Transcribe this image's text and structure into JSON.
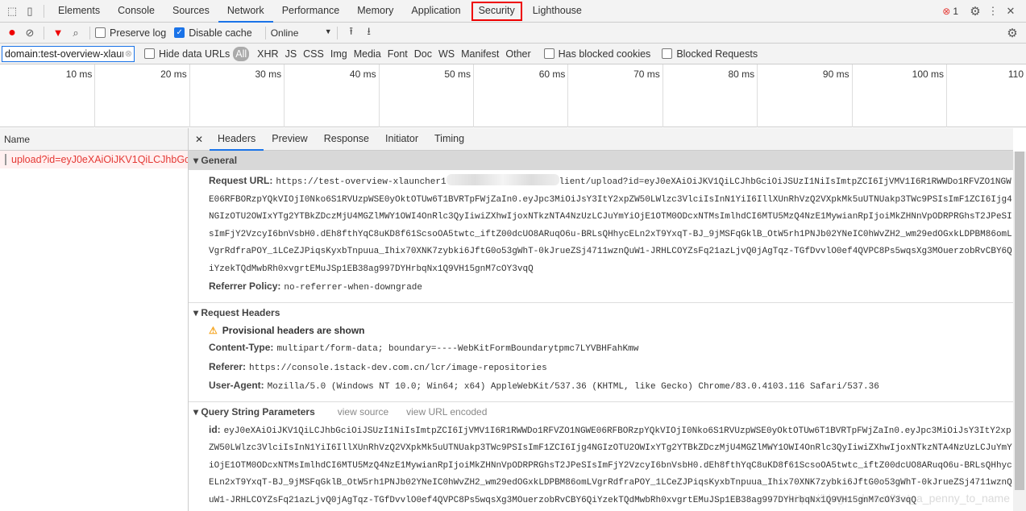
{
  "tabs": [
    "Elements",
    "Console",
    "Sources",
    "Network",
    "Performance",
    "Memory",
    "Application",
    "Security",
    "Lighthouse"
  ],
  "active_tab": "Network",
  "highlighted_tab": "Security",
  "error_count": "1",
  "toolbar": {
    "preserve_log": "Preserve log",
    "preserve_log_checked": false,
    "disable_cache": "Disable cache",
    "disable_cache_checked": true,
    "throttle": "Online"
  },
  "filter": {
    "value": "domain:test-overview-xlaur",
    "hide_data_urls": "Hide data URLs",
    "types": [
      "All",
      "XHR",
      "JS",
      "CSS",
      "Img",
      "Media",
      "Font",
      "Doc",
      "WS",
      "Manifest",
      "Other"
    ],
    "active_type": "All",
    "has_blocked_cookies": "Has blocked cookies",
    "blocked_requests": "Blocked Requests"
  },
  "timeline": [
    "10 ms",
    "20 ms",
    "30 ms",
    "40 ms",
    "50 ms",
    "60 ms",
    "70 ms",
    "80 ms",
    "90 ms",
    "100 ms",
    "110"
  ],
  "requests": {
    "header": "Name",
    "items": [
      "upload?id=eyJ0eXAiOiJKV1QiLCJhbGciOiJ..."
    ]
  },
  "detail_tabs": [
    "Headers",
    "Preview",
    "Response",
    "Initiator",
    "Timing"
  ],
  "active_detail_tab": "Headers",
  "general": {
    "title": "General",
    "request_url_label": "Request URL:",
    "request_url_prefix": "https://test-overview-xlauncher1",
    "request_url_suffix": "lient/upload?id=eyJ0eXAiOiJKV1QiLCJhbGciOiJSUzI1NiIsImtpZCI6IjVMV1I6R1RWWDo1RFVZO1NGWE06RFBORzpYQkVIOjI0Nko6S1RVUzpWSE0yOktOTUw6T1BVRTpFWjZaIn0.eyJpc3MiOiJsY3ItY2xpZW50LWlzc3VlciIsInN1YiI6IllXUnRhVzQ2VXpkMk5uUTNUakp3TWc9PSIsImF1ZCI6Ijg4NGIzOTU2OWIxYTg2YTBkZDczMjU4MGZlMWY1OWI4OnRlc3QyIiwiZXhwIjoxNTkzNTA4NzUzLCJuYmYiOjE1OTM0ODcxNTMsImlhdCI6MTU5MzQ4NzE1MywianRpIjoiMkZHNnVpODRPRGhsT2JPeSIsImFjY2VzcyI6bnVsbH0.dEh8fthYqC8uKD8f61ScsoOA5twtc_iftZ00dcUO8ARuqO6u-BRLsQHhycELn2xT9YxqT-BJ_9jMSFqGklB_OtW5rh1PNJb02YNeIC0hWvZH2_wm29edOGxkLDPBM86omLVgrRdfraPOY_1LCeZJPiqsKyxbTnpuua_Ihix70XNK7zybki6JftG0o53gWhT-0kJrueZSj4711wznQuW1-JRHLCOYZsFq21azLjvQ0jAgTqz-TGfDvvlO0ef4QVPC8Ps5wqsXg3MOuerzobRvCBY6QiYzekTQdMwbRh0xvgrtEMuJSp1EB38ag997DYHrbqNx1Q9VH15gnM7cOY3vqQ",
    "referrer_policy_label": "Referrer Policy:",
    "referrer_policy": "no-referrer-when-downgrade"
  },
  "request_headers": {
    "title": "Request Headers",
    "warning": "Provisional headers are shown",
    "items": [
      {
        "k": "Content-Type:",
        "v": "multipart/form-data; boundary=----WebKitFormBoundarytpmc7LYVBHFahKmw"
      },
      {
        "k": "Referer:",
        "v": "https://console.1stack-dev.com.cn/lcr/image-repositories"
      },
      {
        "k": "User-Agent:",
        "v": "Mozilla/5.0 (Windows NT 10.0; Win64; x64) AppleWebKit/537.36 (KHTML, like Gecko) Chrome/83.0.4103.116 Safari/537.36"
      }
    ]
  },
  "query": {
    "title": "Query String Parameters",
    "view_source": "view source",
    "view_url_encoded": "view URL encoded",
    "key": "id:",
    "value": "eyJ0eXAiOiJKV1QiLCJhbGciOiJSUzI1NiIsImtpZCI6IjVMV1I6R1RWWDo1RFVZO1NGWE06RFBORzpYQkVIOjI0Nko6S1RVUzpWSE0yOktOTUw6T1BVRTpFWjZaIn0.eyJpc3MiOiJsY3ItY2xpZW50LWlzc3VlciIsInN1YiI6IllXUnRhVzQ2VXpkMk5uUTNUakp3TWc9PSIsImF1ZCI6Ijg4NGIzOTU2OWIxYTg2YTBkZDczMjU4MGZlMWY1OWI4OnRlc3QyIiwiZXhwIjoxNTkzNTA4NzUzLCJuYmYiOjE1OTM0ODcxNTMsImlhdCI6MTU5MzQ4NzE1MywianRpIjoiMkZHNnVpODRPRGhsT2JPeSIsImFjY2VzcyI6bnVsbH0.dEh8fthYqC8uKD8f61ScsoOA5twtc_iftZ00dcUO8ARuqO6u-BRLsQHhycELn2xT9YxqT-BJ_9jMSFqGklB_OtW5rh1PNJb02YNeIC0hWvZH2_wm29edOGxkLDPBM86omLVgrRdfraPOY_1LCeZJPiqsKyxbTnpuua_Ihix70XNK7zybki6JftG0o53gWhT-0kJrueZSj4711wznQuW1-JRHLCOYZsFq21azLjvQ0jAgTqz-TGfDvvlO0ef4QVPC8Ps5wqsXg3MOuerzobRvCBY6QiYzekTQdMwbRh0xvgrtEMuJSp1EB38ag997DYHrbqNx1Q9VH15gnM7cOY3vqQ"
  },
  "watermark": "https://blog.csdn.net/Not_a_penny_to_name",
  "colors": {
    "accent": "#1a73e8",
    "error": "#e53935",
    "highlight": "#e00000"
  }
}
